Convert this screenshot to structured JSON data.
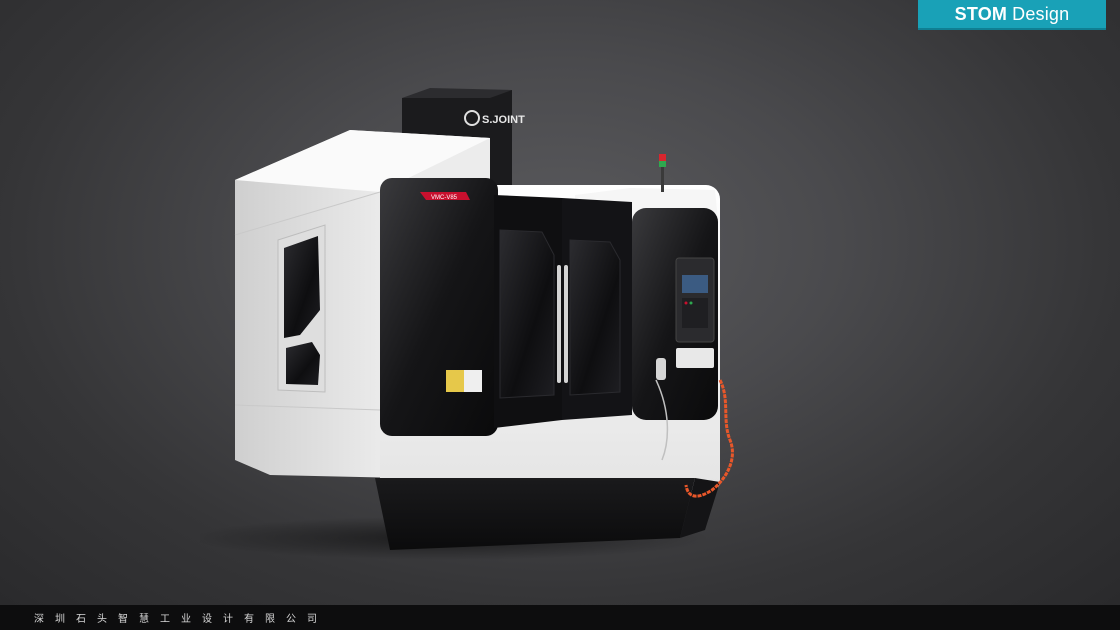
{
  "brand": {
    "name_bold": "STOM",
    "name_light": "Design",
    "color": "#19a1b7"
  },
  "machine": {
    "logo_text": "S.JOINT",
    "model_badge": "VMC-V85",
    "body_color": "#f2f2f2",
    "panel_color": "#1a1a1c",
    "accent_color": "#c8102e",
    "cable_color": "#e8572a"
  },
  "footer": {
    "company": "深圳石头智慧工业设计有限公司"
  }
}
